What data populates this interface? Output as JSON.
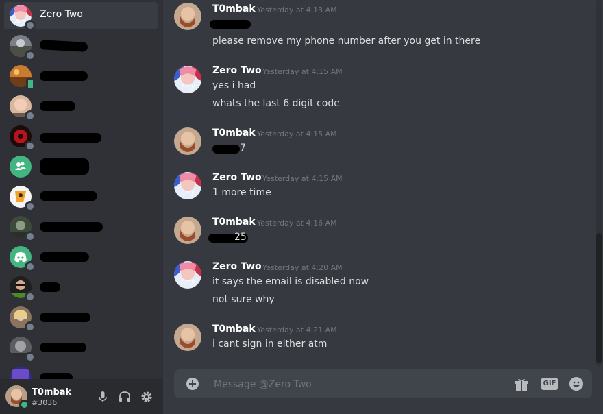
{
  "sidebar": {
    "dm_list": [
      {
        "name": "Zero Two",
        "active": true,
        "avatar": "anime-avatar",
        "status": "offline"
      },
      {
        "name": "",
        "avatar": "landscape-avatar",
        "status": "offline",
        "redacted": true
      },
      {
        "name": "",
        "avatar": "orange-avatar",
        "status": "mobile",
        "redacted": true
      },
      {
        "name": "",
        "avatar": "face-avatar",
        "status": "offline",
        "redacted": true
      },
      {
        "name": "",
        "avatar": "red-avatar",
        "status": "offline",
        "redacted": true
      },
      {
        "name": "",
        "avatar": "group-icon",
        "status": "",
        "redacted": true
      },
      {
        "name": "",
        "avatar": "cartoon-avatar",
        "status": "offline",
        "redacted": true
      },
      {
        "name": "",
        "avatar": "green-avatar",
        "status": "offline",
        "redacted": true
      },
      {
        "name": "",
        "avatar": "discord-logo-avatar",
        "status": "offline",
        "redacted": true
      },
      {
        "name": "",
        "avatar": "sunglasses-avatar",
        "status": "offline",
        "redacted": true
      },
      {
        "name": "",
        "avatar": "blonde-avatar",
        "status": "offline",
        "redacted": true
      },
      {
        "name": "",
        "avatar": "grey-avatar",
        "status": "offline",
        "redacted": true
      },
      {
        "name": "",
        "avatar": "purple-avatar",
        "status": "",
        "redacted": true
      }
    ]
  },
  "user_panel": {
    "username": "T0mbak",
    "discriminator": "#3036",
    "status": "online"
  },
  "chat": {
    "messages": [
      {
        "author": "T0mbak",
        "timestamp": "Yesterday at 4:13 AM",
        "lines": [
          "",
          "please remove my phone number after you get in there"
        ]
      },
      {
        "author": "Zero Two",
        "timestamp": "Yesterday at 4:15 AM",
        "lines": [
          "yes i had",
          "whats the last 6 digit code"
        ]
      },
      {
        "author": "T0mbak",
        "timestamp": "Yesterday at 4:15 AM",
        "lines": [
          "7"
        ]
      },
      {
        "author": "Zero Two",
        "timestamp": "Yesterday at 4:15 AM",
        "lines": [
          "1 more time"
        ]
      },
      {
        "author": "T0mbak",
        "timestamp": "Yesterday at 4:16 AM",
        "lines": [
          "25"
        ]
      },
      {
        "author": "Zero Two",
        "timestamp": "Yesterday at 4:20 AM",
        "lines": [
          "it says the email is disabled now",
          "not sure why"
        ]
      },
      {
        "author": "T0mbak",
        "timestamp": "Yesterday at 4:21 AM",
        "lines": [
          "i cant sign in either atm"
        ]
      }
    ]
  },
  "composer": {
    "placeholder": "Message @Zero Two",
    "gif_label": "GIF"
  },
  "colors": {
    "background": "#36393f",
    "sidebar": "#2f3136",
    "userbar": "#292b2f",
    "input": "#40444b",
    "online": "#43b581",
    "discord_blurple": "#7289da",
    "green_group": "#43b581"
  }
}
